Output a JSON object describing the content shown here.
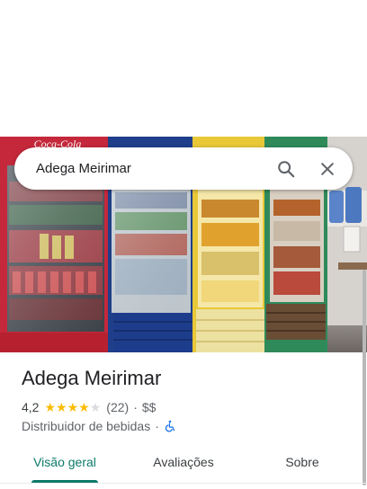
{
  "search": {
    "query": "Adega Meirimar"
  },
  "place": {
    "name": "Adega Meirimar",
    "rating": "4,2",
    "rating_value": 4.2,
    "review_count": "(22)",
    "separator": "·",
    "price_level": "$$",
    "category": "Distribuidor de bebidas"
  },
  "hero": {
    "sign_text": "Coca-Cola"
  },
  "tabs": [
    {
      "label": "Visão geral",
      "active": true
    },
    {
      "label": "Avaliações",
      "active": false
    },
    {
      "label": "Sobre",
      "active": false
    }
  ],
  "icons": {
    "search": "search-icon",
    "close": "close-icon",
    "star": "star-icon",
    "accessibility": "wheelchair-icon",
    "photo": "storefront-photo"
  },
  "colors": {
    "accent": "#0b7a6a",
    "star": "#fbbc04",
    "accessibility": "#1a73e8"
  }
}
